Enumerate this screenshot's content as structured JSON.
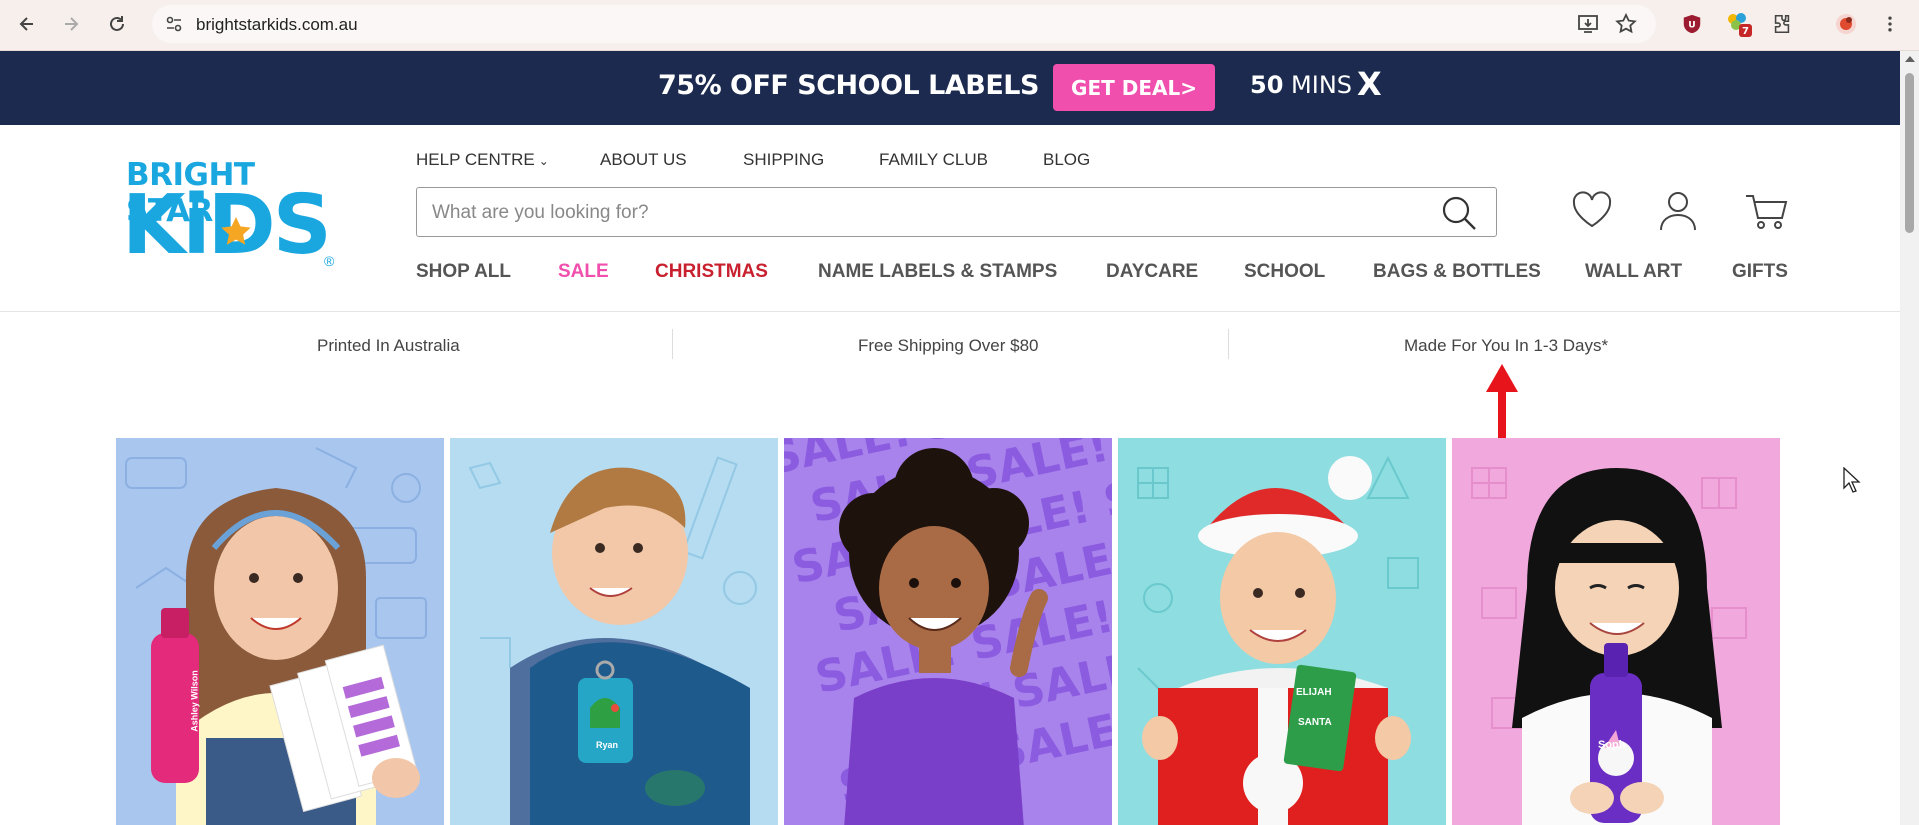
{
  "browser": {
    "url": "brightstarkids.com.au",
    "extension_badge": "7"
  },
  "promo": {
    "title": "75% OFF SCHOOL LABELS",
    "button": "GET DEAL>",
    "timer_value": "50",
    "timer_unit": "MINS",
    "close": "X",
    "bg_color": "#1b2a4e",
    "button_color": "#f04fae"
  },
  "logo": {
    "line1": "BRIGHT STAR",
    "line2": "KiDS",
    "reg": "®"
  },
  "top_nav": {
    "help": "HELP CENTRE",
    "about": "ABOUT US",
    "shipping": "SHIPPING",
    "family": "FAMILY CLUB",
    "blog": "BLOG"
  },
  "search": {
    "placeholder": "What are you looking for?"
  },
  "main_nav": {
    "shop_all": "SHOP ALL",
    "sale": "SALE",
    "christmas": "CHRISTMAS",
    "labels": "NAME LABELS & STAMPS",
    "daycare": "DAYCARE",
    "school": "SCHOOL",
    "bags": "BAGS & BOTTLES",
    "wall_art": "WALL ART",
    "gifts": "GIFTS"
  },
  "usp": {
    "printed": "Printed In Australia",
    "shipping": "Free Shipping Over $80",
    "made": "Made For You In 1-3 Days*"
  },
  "tiles": {
    "t1_bottle_name": "Ashley Wilson",
    "t2_tag_name": "Ryan",
    "t3_sale_word": "SALE!",
    "t4_tag_line1": "ELIJAH",
    "t4_tag_line2": "SANTA",
    "t5_bottle_name": "Soph"
  },
  "colors": {
    "accent_blue": "#1aa7e0",
    "sale_pink": "#f04fae",
    "christmas_red": "#c8202f",
    "arrow_red": "#e8141c"
  }
}
